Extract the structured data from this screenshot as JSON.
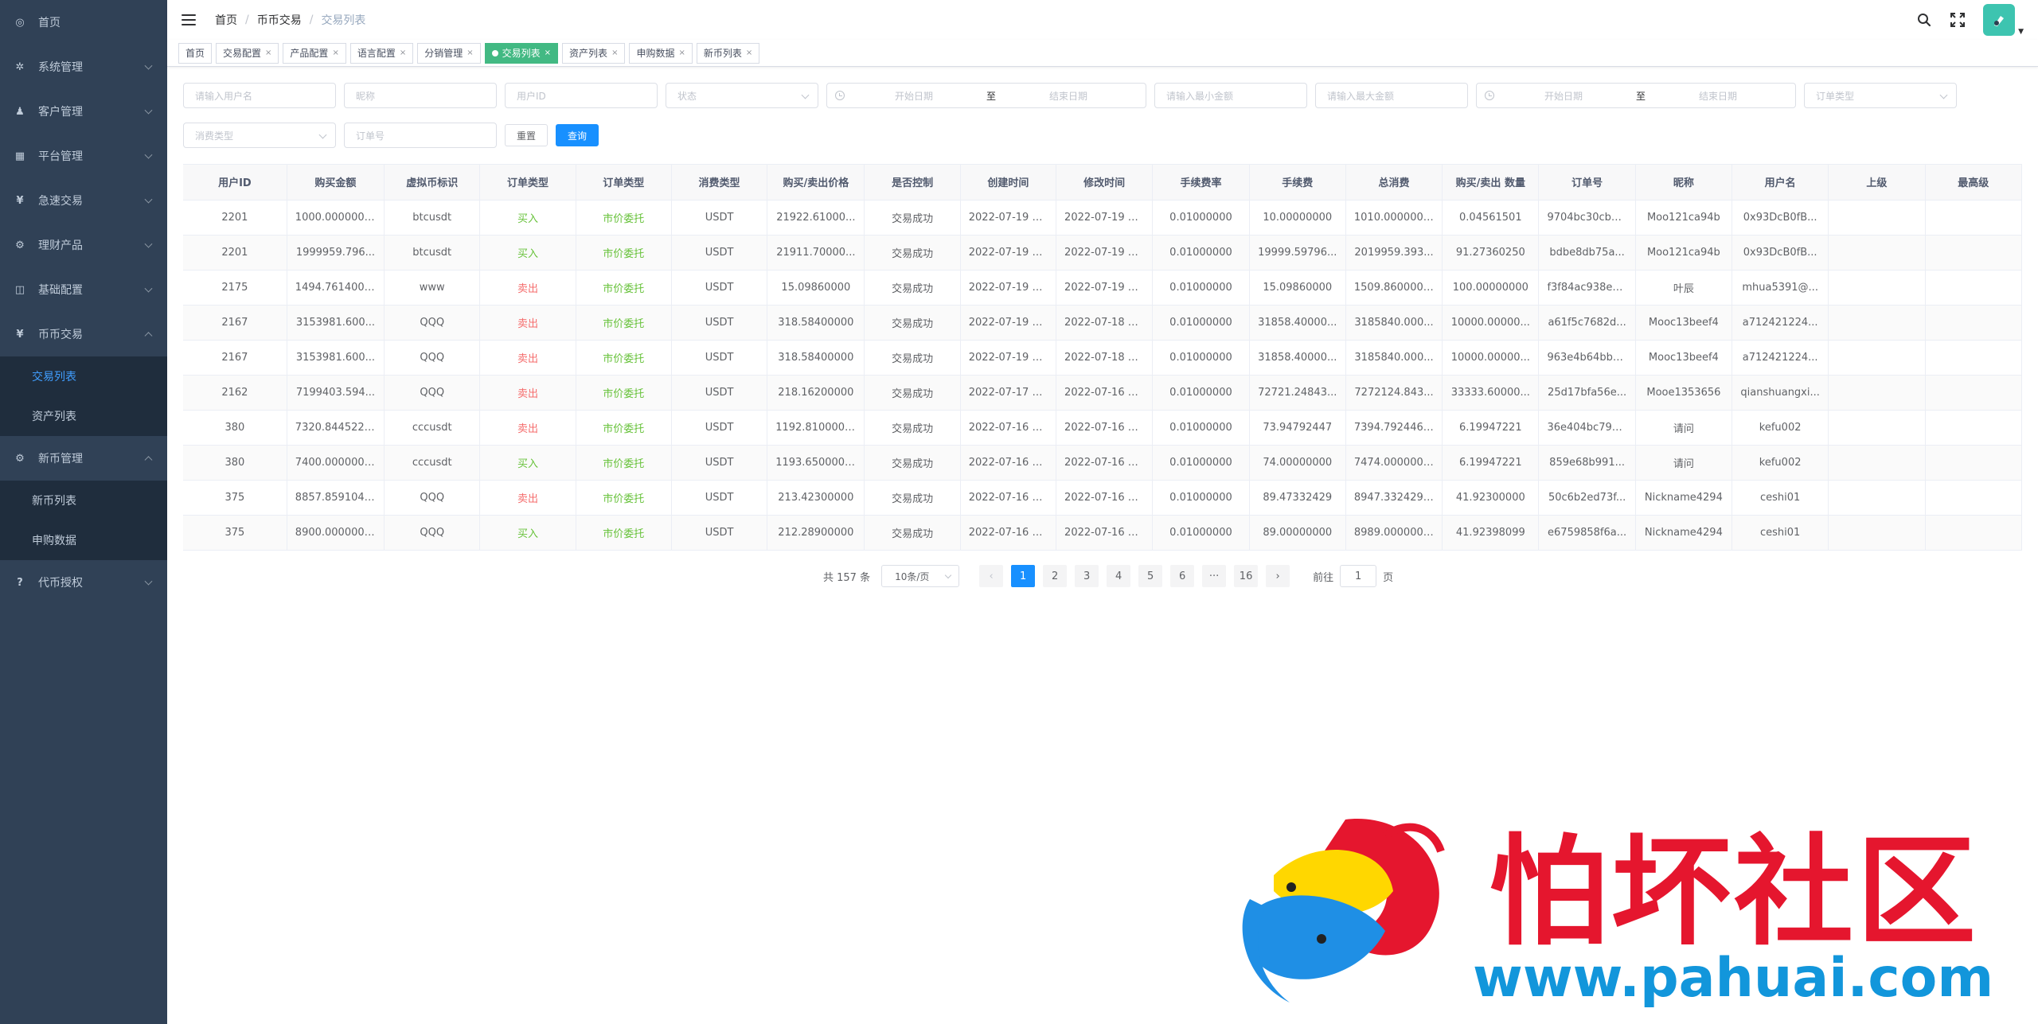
{
  "sidebar": {
    "items": [
      {
        "label": "首页",
        "icon": "dashboard-icon",
        "glyph": "◎"
      },
      {
        "label": "系统管理",
        "icon": "gear-icon",
        "glyph": "✲",
        "arrow": "down"
      },
      {
        "label": "客户管理",
        "icon": "users-icon",
        "glyph": "♟",
        "arrow": "down"
      },
      {
        "label": "平台管理",
        "icon": "grid-icon",
        "glyph": "▦",
        "arrow": "down"
      },
      {
        "label": "急速交易",
        "icon": "yen-icon",
        "glyph": "¥",
        "arrow": "down"
      },
      {
        "label": "理财产品",
        "icon": "settings-icon",
        "glyph": "⚙",
        "arrow": "down"
      },
      {
        "label": "基础配置",
        "icon": "book-icon",
        "glyph": "◫",
        "arrow": "down"
      },
      {
        "label": "币币交易",
        "icon": "yen-icon",
        "glyph": "¥",
        "arrow": "up",
        "children": [
          {
            "label": "交易列表",
            "active": true
          },
          {
            "label": "资产列表"
          }
        ]
      },
      {
        "label": "新币管理",
        "icon": "settings-icon",
        "glyph": "⚙",
        "arrow": "up",
        "children": [
          {
            "label": "新币列表"
          },
          {
            "label": "申购数据"
          }
        ]
      },
      {
        "label": "代币授权",
        "icon": "help-icon",
        "glyph": "?",
        "arrow": "down"
      }
    ]
  },
  "navbar": {
    "breadcrumb": [
      "首页",
      "币币交易",
      "交易列表"
    ]
  },
  "tags": [
    {
      "label": "首页",
      "closable": false
    },
    {
      "label": "交易配置",
      "closable": true
    },
    {
      "label": "产品配置",
      "closable": true
    },
    {
      "label": "语言配置",
      "closable": true
    },
    {
      "label": "分销管理",
      "closable": true
    },
    {
      "label": "交易列表",
      "closable": true,
      "active": true
    },
    {
      "label": "资产列表",
      "closable": true
    },
    {
      "label": "申购数据",
      "closable": true
    },
    {
      "label": "新币列表",
      "closable": true
    }
  ],
  "filters": {
    "username": "请输入用户名",
    "nickname": "昵称",
    "user_id": "用户ID",
    "status": "状态",
    "date_start": "开始日期",
    "date_sep": "至",
    "date_end": "结束日期",
    "min_amount": "请输入最小金额",
    "max_amount": "请输入最大金额",
    "date2_start": "开始日期",
    "date2_sep": "至",
    "date2_end": "结束日期",
    "order_type": "订单类型",
    "consume_type": "消费类型",
    "order_no": "订单号",
    "reset": "重置",
    "search": "查询"
  },
  "table": {
    "columns": [
      "用户ID",
      "购买金额",
      "虚拟币标识",
      "订单类型",
      "订单类型",
      "消费类型",
      "购买/卖出价格",
      "是否控制",
      "创建时间",
      "修改时间",
      "手续费率",
      "手续费",
      "总消费",
      "购买/卖出 数量",
      "订单号",
      "昵称",
      "用户名",
      "上级",
      "最高级"
    ],
    "rows": [
      [
        "2201",
        "1000.00000000",
        "btcusdt",
        "买入",
        "市价委托",
        "USDT",
        "21922.61000...",
        "交易成功",
        "2022-07-19 1...",
        "2022-07-19 0...",
        "0.01000000",
        "10.00000000",
        "1010.00000000",
        "0.04561501",
        "9704bc30cb6...",
        "Moo121ca94b",
        "0x93DcB0fB...",
        "",
        ""
      ],
      [
        "2201",
        "1999959.796...",
        "btcusdt",
        "买入",
        "市价委托",
        "USDT",
        "21911.70000...",
        "交易成功",
        "2022-07-19 1...",
        "2022-07-19 0...",
        "0.01000000",
        "19999.59796...",
        "2019959.393...",
        "91.27360250",
        "bdbe8db75a...",
        "Moo121ca94b",
        "0x93DcB0fB...",
        "",
        ""
      ],
      [
        "2175",
        "1494.76140000",
        "www",
        "卖出",
        "市价委托",
        "USDT",
        "15.09860000",
        "交易成功",
        "2022-07-19 1...",
        "2022-07-19 0...",
        "0.01000000",
        "15.09860000",
        "1509.86000000",
        "100.00000000",
        "f3f84ac938ee...",
        "叶辰",
        "mhua5391@...",
        "",
        ""
      ],
      [
        "2167",
        "3153981.600...",
        "QQQ",
        "卖出",
        "市价委托",
        "USDT",
        "318.58400000",
        "交易成功",
        "2022-07-19 0...",
        "2022-07-18 1...",
        "0.01000000",
        "31858.40000...",
        "3185840.000...",
        "10000.00000...",
        "a61f5c7682d...",
        "Mooc13beef4",
        "a712421224...",
        "",
        ""
      ],
      [
        "2167",
        "3153981.600...",
        "QQQ",
        "卖出",
        "市价委托",
        "USDT",
        "318.58400000",
        "交易成功",
        "2022-07-19 0...",
        "2022-07-18 1...",
        "0.01000000",
        "31858.40000...",
        "3185840.000...",
        "10000.00000...",
        "963e4b64bbc...",
        "Mooc13beef4",
        "a712421224...",
        "",
        ""
      ],
      [
        "2162",
        "7199403.594...",
        "QQQ",
        "卖出",
        "市价委托",
        "USDT",
        "218.16200000",
        "交易成功",
        "2022-07-17 0...",
        "2022-07-16 1...",
        "0.01000000",
        "72721.24843...",
        "7272124.843...",
        "33333.60000...",
        "25d17bfa56e...",
        "Mooe1353656",
        "qianshuangxi...",
        "",
        ""
      ],
      [
        "380",
        "7320.84452234",
        "cccusdt",
        "卖出",
        "市价委托",
        "USDT",
        "1192.81000000",
        "交易成功",
        "2022-07-16 1...",
        "2022-07-16 0...",
        "0.01000000",
        "73.94792447",
        "7394.79244681",
        "6.19947221",
        "36e404bc79a...",
        "请问",
        "kefu002",
        "",
        ""
      ],
      [
        "380",
        "7400.00000000",
        "cccusdt",
        "买入",
        "市价委托",
        "USDT",
        "1193.65000000",
        "交易成功",
        "2022-07-16 1...",
        "2022-07-16 0...",
        "0.01000000",
        "74.00000000",
        "7474.00000000",
        "6.19947221",
        "859e68b991...",
        "请问",
        "kefu002",
        "",
        ""
      ],
      [
        "375",
        "8857.85910471",
        "QQQ",
        "卖出",
        "市价委托",
        "USDT",
        "213.42300000",
        "交易成功",
        "2022-07-16 1...",
        "2022-07-16 0...",
        "0.01000000",
        "89.47332429",
        "8947.33242900",
        "41.92300000",
        "50c6b2ed73f...",
        "Nickname4294",
        "ceshi01",
        "",
        ""
      ],
      [
        "375",
        "8900.00000000",
        "QQQ",
        "买入",
        "市价委托",
        "USDT",
        "212.28900000",
        "交易成功",
        "2022-07-16 1...",
        "2022-07-16 0...",
        "0.01000000",
        "89.00000000",
        "8989.00000000",
        "41.92398099",
        "e6759858f6a...",
        "Nickname4294",
        "ceshi01",
        "",
        ""
      ]
    ]
  },
  "pagination": {
    "total": "共 157 条",
    "page_size": "10条/页",
    "pages": [
      "1",
      "2",
      "3",
      "4",
      "5",
      "6",
      "···",
      "16"
    ],
    "current": "1",
    "goto_prefix": "前往",
    "goto_value": "1",
    "goto_suffix": "页"
  },
  "watermark": {
    "title": "怕坏社区",
    "url": "www.pahuai.com"
  },
  "colors": {
    "sidebar_bg": "#304156",
    "submenu_bg": "#1f2d3d",
    "active_tag": "#42b983",
    "primary": "#1890ff",
    "buy": "#67c23a",
    "sell": "#f56c6c"
  }
}
